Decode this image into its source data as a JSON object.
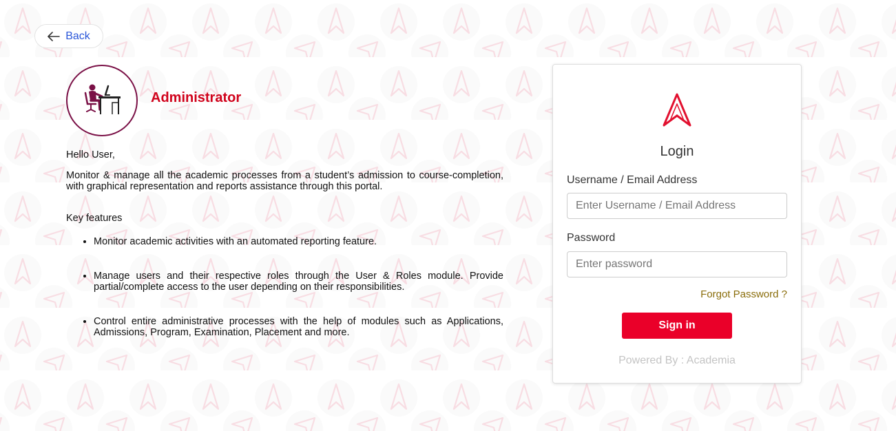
{
  "nav": {
    "back_label": "Back",
    "back_icon": "arrow-left-icon"
  },
  "role": {
    "title": "Administrator",
    "icon": "admin-desk-icon"
  },
  "intro": {
    "greeting": "Hello User,",
    "description": "Monitor & manage all the academic processes from a student’s admission to course-completion, with graphical representation and reports assistance through this portal.",
    "key_features_title": "Key features",
    "features": [
      "Monitor academic activities with an automated reporting feature.",
      "Manage users and their respective roles through the User & Roles module. Provide partial/complete access to the user depending on their responsibilities.",
      "Control entire administrative processes with the help of modules such as Applications, Admissions, Program, Examination, Placement and more."
    ]
  },
  "login": {
    "logo_icon": "academia-logo-icon",
    "title": "Login",
    "username_label": "Username / Email Address",
    "username_placeholder": "Enter Username / Email Address",
    "username_value": "",
    "password_label": "Password",
    "password_placeholder": "Enter password",
    "password_value": "",
    "forgot_label": "Forgot Password ?",
    "signin_label": "Sign in",
    "powered_by": "Powered By : Academia"
  },
  "colors": {
    "brand_red": "#ea0029",
    "role_title": "#d0021b",
    "avatar_purple": "#7a1046",
    "back_link": "#2b57d9",
    "forgot_link": "#8a6d0b",
    "pattern": "#f6d5dc"
  }
}
